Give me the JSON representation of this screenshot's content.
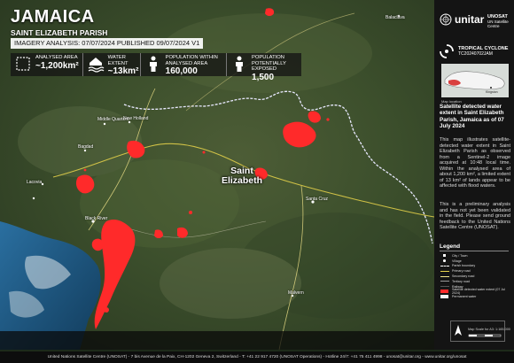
{
  "header": {
    "title": "JAMAICA",
    "subtitle": "SAINT ELIZABETH PARISH",
    "analysis_line": "IMAGERY ANALYSIS: 07/07/2024 PUBLISHED 09/07/2024 V1"
  },
  "stats": [
    {
      "label": "ANALYSED AREA",
      "value": "~1,200km²",
      "icon": "area-icon"
    },
    {
      "label": "WATER EXTENT",
      "value": "~13km²",
      "icon": "water-icon"
    },
    {
      "label": "POPULATION WITHIN ANALYSED AREA",
      "value": "160,000",
      "icon": "person-icon"
    },
    {
      "label": "POPULATION POTENTIALLY EXPOSED",
      "value": "1,500",
      "icon": "person-icon"
    }
  ],
  "map": {
    "region_label": "Saint Elizabeth",
    "places": [
      "Balaclava",
      "Middle Quarters",
      "New Holland",
      "Bagdad",
      "Lacovia",
      "Santa Cruz",
      "Black River",
      "Malvern"
    ]
  },
  "sidebar": {
    "brand": "unitar",
    "org_lines": [
      "UNOSAT",
      "UN Satellite Centre"
    ],
    "hazard_title": "TROPICAL CYCLONE",
    "glide": "TC20240702JAM",
    "inset_caption": "Map location",
    "inset_label": "Kingston",
    "title": "Satellite detected water extent in Saint Elizabeth Parish, Jamaica as of 07 July 2024",
    "description": "This map illustrates satellite-detected water extent in Saint Elizabeth Parish as observed from a Sentinel-2 image acquired at 10:48 local time. Within the analysed area of about 1,200 km², a limited extent of 13 km² of lands appear to be affected with flood waters.",
    "note": "This is a preliminary analysis and has not yet been validated in the field. Please send ground feedback to the United Nations Satellite Centre (UNOSAT).",
    "legend_title": "Legend",
    "legend": [
      {
        "label": "City / Town",
        "symbol": "square-white"
      },
      {
        "label": "Village",
        "symbol": "dot-white"
      },
      {
        "label": "Parish boundary",
        "symbol": "line-dash-white"
      },
      {
        "label": "Primary road",
        "symbol": "line-yellow"
      },
      {
        "label": "Secondary road",
        "symbol": "line-lightyellow"
      },
      {
        "label": "Tertiary road",
        "symbol": "line-grey"
      },
      {
        "label": "Railway",
        "symbol": "line-dark"
      },
      {
        "label": "Satellite detected water extent (07 Jul 2024)",
        "symbol": "fill-red"
      },
      {
        "label": "Permanent water",
        "symbol": "fill-white"
      }
    ],
    "scale_text": "Map Scale for A3: 1:165,000"
  },
  "footer": "United Nations Satellite Centre (UNOSAT) - 7 bis Avenue de la Paix, CH-1202 Geneva 2, Switzerland - T: +41 22 917 4720 (UNOSAT Operations) - Hotline 24/7: +41 75 411 4998 - unosat@unitar.org - www.unitar.org/unosat",
  "colors": {
    "flood": "#ff2a2a",
    "boundary": "#e9e9ff",
    "road": "#e8d44a",
    "sidebar": "#141414"
  }
}
